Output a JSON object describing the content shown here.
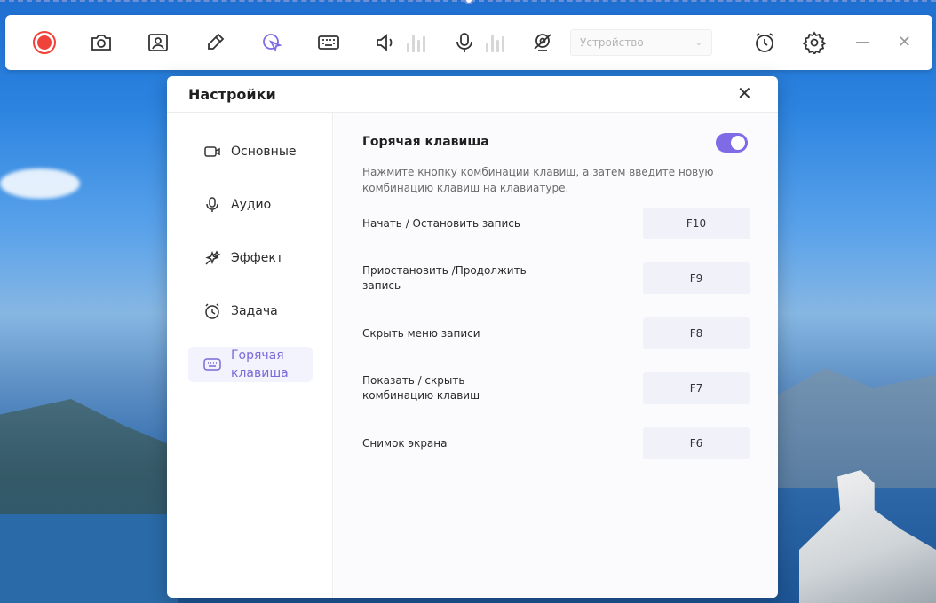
{
  "toolbar": {
    "device_placeholder": "Устройство",
    "icons": [
      "record-button",
      "camera-icon",
      "webcam-icon",
      "pen-icon",
      "cursor-icon",
      "keyboard-icon",
      "speaker-icon",
      "microphone-icon",
      "webcam-off-icon",
      "timer-icon",
      "gear-icon"
    ]
  },
  "dialog": {
    "title": "Настройки",
    "close_glyph": "✕",
    "sidebar": [
      {
        "label": "Основные",
        "icon": "video-icon",
        "active": false
      },
      {
        "label": "Аудио",
        "icon": "microphone-icon",
        "active": false
      },
      {
        "label": "Эффект",
        "icon": "sparkle-icon",
        "active": false
      },
      {
        "label": "Задача",
        "icon": "alarm-clock-icon",
        "active": false
      },
      {
        "label": "Горячая клавиша",
        "icon": "keyboard-icon",
        "active": true
      }
    ],
    "hotkey": {
      "title": "Горячая клавиша",
      "enabled": true,
      "description": "Нажмите кнопку комбинации клавиш, а затем введите новую комбинацию клавиш на клавиатуре.",
      "rows": [
        {
          "label": "Начать / Остановить запись",
          "key": "F10"
        },
        {
          "label": "Приостановить /Продолжить запись",
          "key": "F9"
        },
        {
          "label": "Скрыть меню записи",
          "key": "F8"
        },
        {
          "label": "Показать / скрыть комбинацию клавиш",
          "key": "F7"
        },
        {
          "label": "Снимок экрана",
          "key": "F6"
        }
      ]
    }
  },
  "colors": {
    "accent": "#7f6be6",
    "record": "#f0413a",
    "active_label": "#7a6ad8"
  }
}
